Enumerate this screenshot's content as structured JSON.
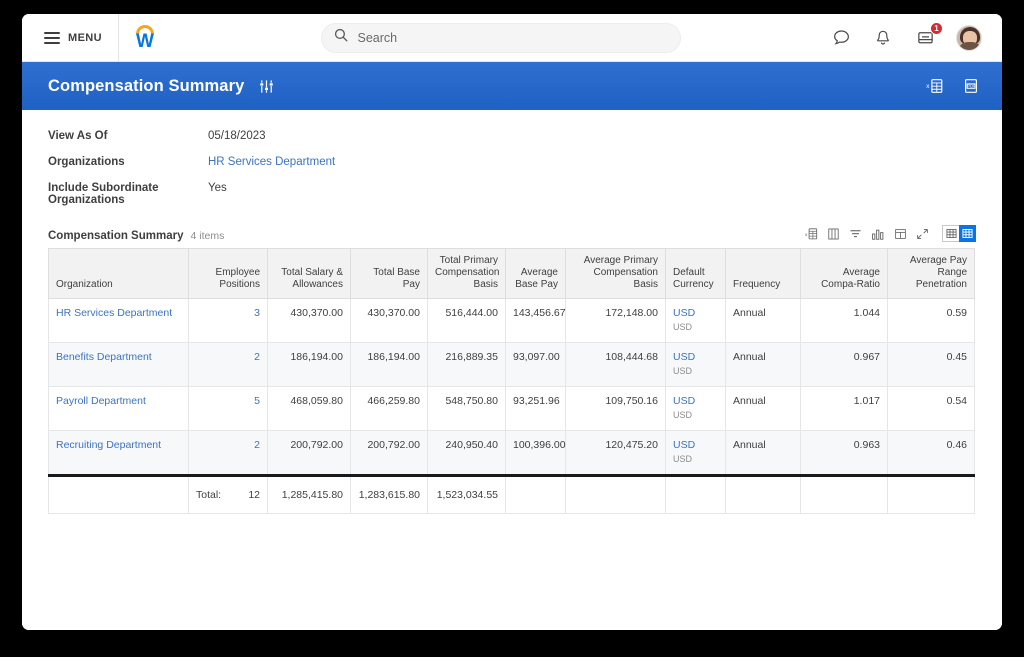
{
  "topbar": {
    "menu_label": "MENU",
    "brand_letter": "W",
    "search_placeholder": "Search",
    "search_value": "",
    "inbox_badge": "1"
  },
  "page_header": {
    "title": "Compensation Summary"
  },
  "fields": [
    {
      "label": "View As Of",
      "value": "05/18/2023",
      "link": false
    },
    {
      "label": "Organizations",
      "value": "HR Services Department",
      "link": true
    },
    {
      "label": "Include Subordinate Organizations",
      "value": "Yes",
      "link": false
    }
  ],
  "table": {
    "caption": "Compensation Summary",
    "count_label": "4 items",
    "columns": [
      {
        "label": "Organization",
        "align": "l"
      },
      {
        "label": "Employee Positions",
        "align": "r"
      },
      {
        "label": "Total Salary & Allowances",
        "align": "r"
      },
      {
        "label": "Total Base Pay",
        "align": "r"
      },
      {
        "label": "Total Primary Compensation Basis",
        "align": "r"
      },
      {
        "label": "Average Base Pay",
        "align": "r"
      },
      {
        "label": "Average Primary Compensation Basis",
        "align": "r"
      },
      {
        "label": "Default Currency",
        "align": "l"
      },
      {
        "label": "Frequency",
        "align": "l"
      },
      {
        "label": "Average Compa-Ratio",
        "align": "r"
      },
      {
        "label": "Average Pay Range Penetration",
        "align": "r"
      }
    ],
    "rows": [
      {
        "organization": "HR Services Department",
        "employee_positions": "3",
        "total_salary_allowances": "430,370.00",
        "total_base_pay": "430,370.00",
        "total_primary_compensation_basis": "516,444.00",
        "average_base_pay": "143,456.67",
        "average_primary_compensation_basis": "172,148.00",
        "default_currency": "USD",
        "default_currency_sub": "USD",
        "frequency": "Annual",
        "average_compa_ratio": "1.044",
        "average_pay_range_penetration": "0.59"
      },
      {
        "organization": "Benefits Department",
        "employee_positions": "2",
        "total_salary_allowances": "186,194.00",
        "total_base_pay": "186,194.00",
        "total_primary_compensation_basis": "216,889.35",
        "average_base_pay": "93,097.00",
        "average_primary_compensation_basis": "108,444.68",
        "default_currency": "USD",
        "default_currency_sub": "USD",
        "frequency": "Annual",
        "average_compa_ratio": "0.967",
        "average_pay_range_penetration": "0.45"
      },
      {
        "organization": "Payroll Department",
        "employee_positions": "5",
        "total_salary_allowances": "468,059.80",
        "total_base_pay": "466,259.80",
        "total_primary_compensation_basis": "548,750.80",
        "average_base_pay": "93,251.96",
        "average_primary_compensation_basis": "109,750.16",
        "default_currency": "USD",
        "default_currency_sub": "USD",
        "frequency": "Annual",
        "average_compa_ratio": "1.017",
        "average_pay_range_penetration": "0.54"
      },
      {
        "organization": "Recruiting Department",
        "employee_positions": "2",
        "total_salary_allowances": "200,792.00",
        "total_base_pay": "200,792.00",
        "total_primary_compensation_basis": "240,950.40",
        "average_base_pay": "100,396.00",
        "average_primary_compensation_basis": "120,475.20",
        "default_currency": "USD",
        "default_currency_sub": "USD",
        "frequency": "Annual",
        "average_compa_ratio": "0.963",
        "average_pay_range_penetration": "0.46"
      }
    ],
    "totals": {
      "label": "Total:",
      "employee_positions": "12",
      "total_salary_allowances": "1,285,415.80",
      "total_base_pay": "1,283,615.80",
      "total_primary_compensation_basis": "1,523,034.55"
    },
    "toolbar_icons": [
      "export-to-excel-icon",
      "column-settings-icon",
      "filter-icon",
      "chart-view-icon",
      "table-layout-icon",
      "expand-icon"
    ]
  },
  "colors": {
    "header_blue": "#1f61c4",
    "link_blue": "#3b73c4",
    "active_blue": "#0875e1",
    "badge_red": "#d8292f",
    "brand_orange": "#f5a623"
  }
}
